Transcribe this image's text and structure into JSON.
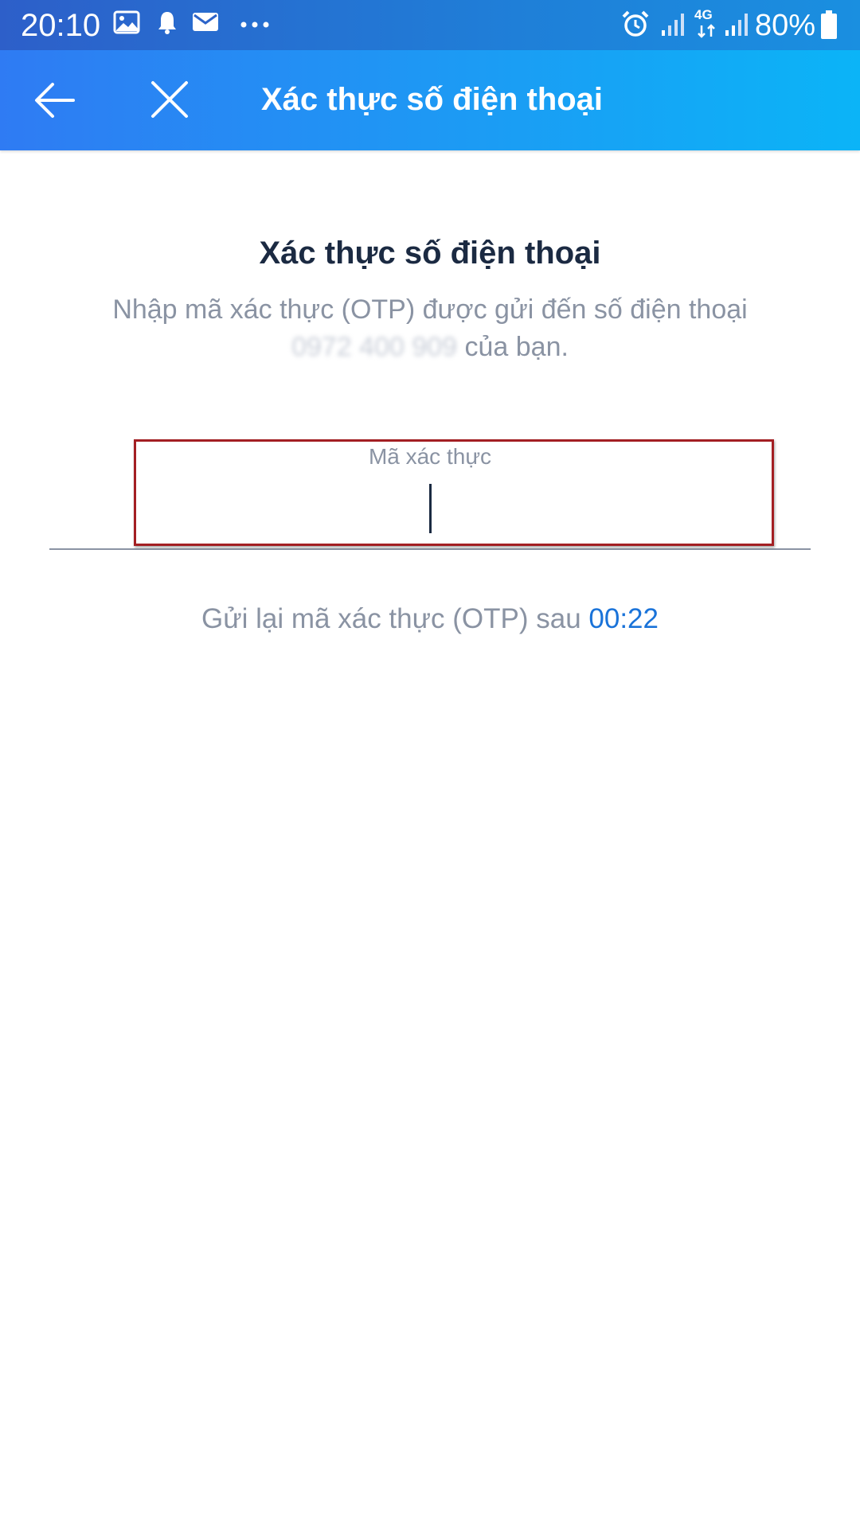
{
  "status_bar": {
    "time": "20:10",
    "battery": "80%",
    "network_label": "4G",
    "icons": [
      "image-icon",
      "bell-icon",
      "mail-icon",
      "more-dots-icon",
      "alarm-icon",
      "signal-icon",
      "4g-data-icon",
      "signal-icon",
      "battery-icon"
    ]
  },
  "app_bar": {
    "title": "Xác thực số điện thoại",
    "back_icon": "arrow-left-icon",
    "close_icon": "close-icon"
  },
  "main": {
    "heading": "Xác thực số điện thoại",
    "instruction_line1": "Nhập mã xác thực (OTP) được gửi đến số điện thoại",
    "phone_number": "0972 400 909",
    "instruction_suffix": " của bạn."
  },
  "otp_input": {
    "label": "Mã xác thực",
    "value": ""
  },
  "resend": {
    "text": "Gửi lại mã xác thực (OTP) sau ",
    "countdown": "00:22"
  },
  "colors": {
    "app_bar_start": "#2f7bf3",
    "app_bar_end": "#0bb4f7",
    "heading_text": "#1b2a42",
    "muted_text": "#8a93a3",
    "link_blue": "#1a73d9",
    "highlight_border": "#a31f23"
  }
}
